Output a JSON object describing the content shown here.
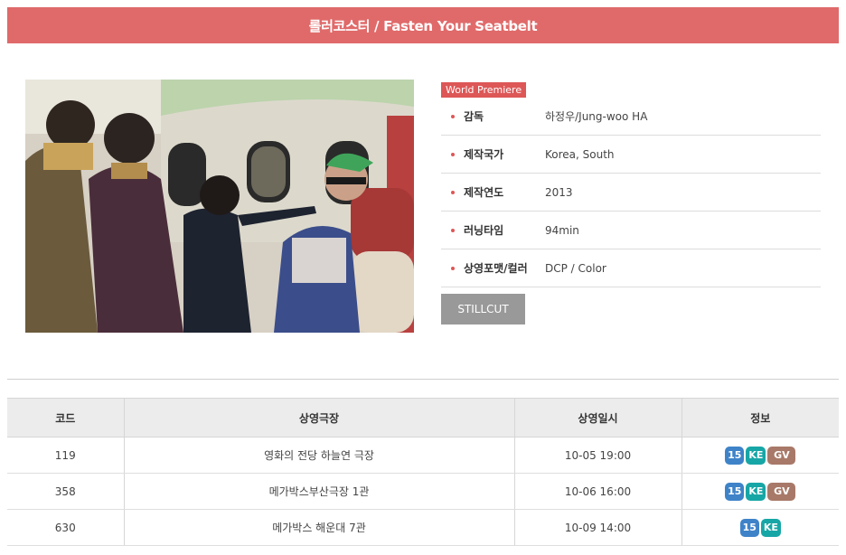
{
  "header": {
    "title": "롤러코스터 / Fasten Your Seatbelt"
  },
  "poster": {
    "alt": "still"
  },
  "info": {
    "badge": "World Premiere",
    "rows": [
      {
        "label": "감독",
        "value": "하정우/Jung-woo HA"
      },
      {
        "label": "제작국가",
        "value": "Korea, South"
      },
      {
        "label": "제작연도",
        "value": "2013"
      },
      {
        "label": "러닝타임",
        "value": "94min"
      },
      {
        "label": "상영포맷/컬러",
        "value": "DCP / Color"
      }
    ],
    "stillcut_label": "STILLCUT"
  },
  "schedule": {
    "headers": [
      "코드",
      "상영극장",
      "상영일시",
      "정보"
    ],
    "rows": [
      {
        "code": "119",
        "theater": "영화의 전당 하늘연 극장",
        "datetime": "10-05 19:00",
        "tags": [
          "15",
          "KE",
          "GV"
        ]
      },
      {
        "code": "358",
        "theater": "메가박스부산극장 1관",
        "datetime": "10-06 16:00",
        "tags": [
          "15",
          "KE",
          "GV"
        ]
      },
      {
        "code": "630",
        "theater": "메가박스 해운대 7관",
        "datetime": "10-09 14:00",
        "tags": [
          "15",
          "KE"
        ]
      }
    ]
  },
  "colors": {
    "accent": "#e06a6a",
    "tag_age": "#3e83c8",
    "tag_ke": "#17a6a6",
    "tag_gv": "#a87968"
  }
}
